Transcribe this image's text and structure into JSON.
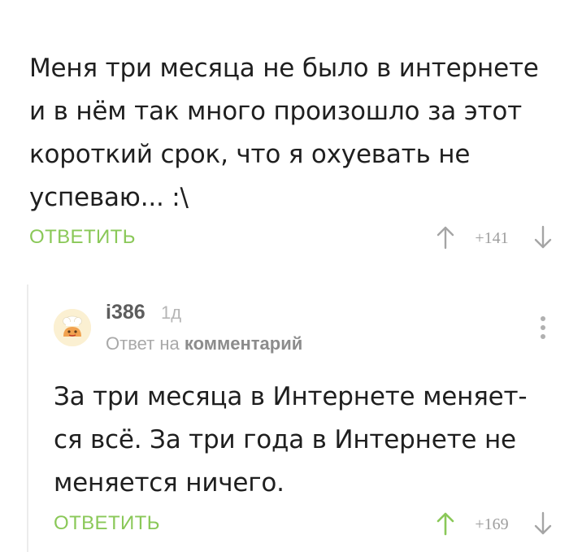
{
  "comment": {
    "text": "Меня три месяца не было в интернете\nи в нём так много произошло за этот\nкороткий срок, что я охуевать не\nуспеваю... :\\",
    "reply_label": "ОТВЕТИТЬ",
    "score": "+141",
    "up_vote_active": false
  },
  "reply": {
    "username": "i386",
    "time": "1д",
    "reply_prefix": "Ответ на",
    "reply_link": "комментарий",
    "text": "За три месяца в Интернете меняет-\nся всё. За три года в Интернете не\nменяется ничего.",
    "reply_label": "ОТВЕТИТЬ",
    "score": "+169",
    "up_vote_active": true
  },
  "icons": {
    "vote_up": "arrow-up-icon",
    "vote_down": "arrow-down-icon",
    "more": "vertical-dots-icon"
  },
  "colors": {
    "accent_green": "#8ac858",
    "muted_gray": "#9e9e9e",
    "text": "#1f1f1f"
  }
}
